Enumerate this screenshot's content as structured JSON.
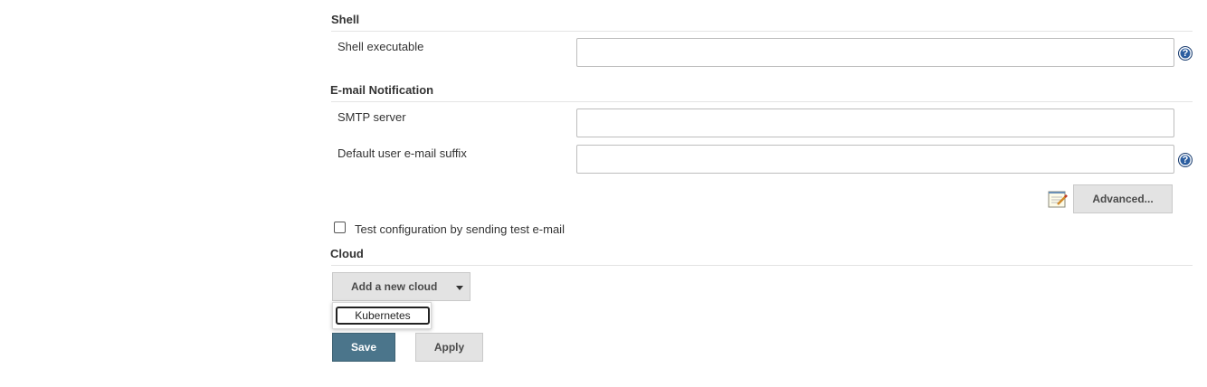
{
  "sections": {
    "shell": {
      "title": "Shell",
      "shell_executable_label": "Shell executable",
      "shell_executable_value": ""
    },
    "email": {
      "title": "E-mail Notification",
      "smtp_server_label": "SMTP server",
      "smtp_server_value": "",
      "suffix_label": "Default user e-mail suffix",
      "suffix_value": "",
      "advanced_label": "Advanced...",
      "test_config_label": "Test configuration by sending test e-mail",
      "test_config_checked": false
    },
    "cloud": {
      "title": "Cloud",
      "add_cloud_label": "Add a new cloud",
      "menu_items": [
        "Kubernetes"
      ]
    }
  },
  "footer": {
    "save_label": "Save",
    "apply_label": "Apply"
  },
  "icons": {
    "help": "help-icon",
    "notepad": "notepad-icon",
    "caret": "chevron-down-icon"
  },
  "colors": {
    "primary_button": "#4b758b",
    "help_icon": "#2c5ea0"
  }
}
